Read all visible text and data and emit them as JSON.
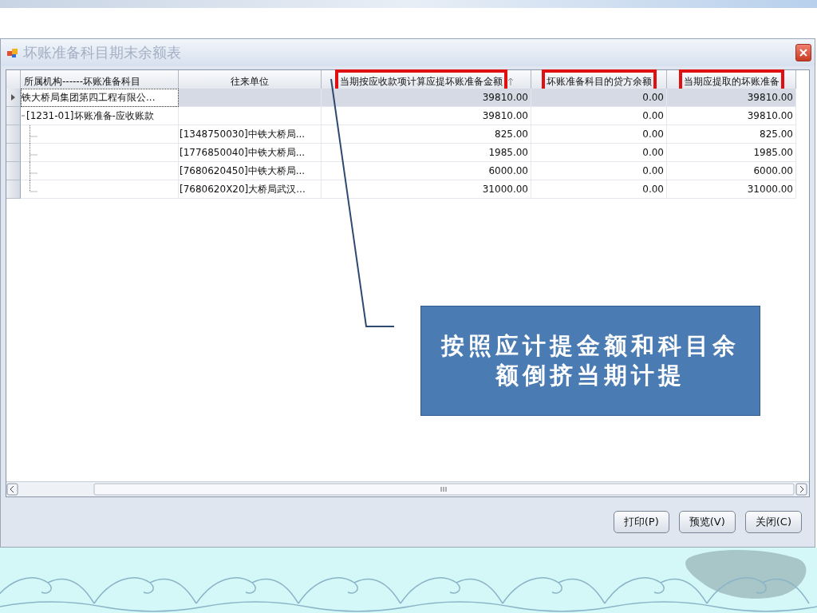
{
  "window": {
    "title": "坏账准备科目期末余额表"
  },
  "table": {
    "columns": [
      {
        "label": "所属机构------坏账准备科目",
        "highlighted": false,
        "sorted": false
      },
      {
        "label": "往来单位",
        "highlighted": false,
        "sorted": false
      },
      {
        "label": "当期按应收款项计算应提坏账准备金额",
        "highlighted": true,
        "sorted": true
      },
      {
        "label": "坏账准备科目的贷方余额",
        "highlighted": true,
        "sorted": false
      },
      {
        "label": "当期应提取的坏账准备",
        "highlighted": true,
        "sorted": false
      }
    ],
    "rows": [
      {
        "kind": "group",
        "selected": true,
        "cells": [
          "铁大桥局集团第四工程有限公...",
          "",
          "39810.00",
          "0.00",
          "39810.00"
        ]
      },
      {
        "kind": "account",
        "selected": false,
        "cells": [
          "[1231-01]坏账准备-应收账款",
          "",
          "39810.00",
          "0.00",
          "39810.00"
        ]
      },
      {
        "kind": "detail",
        "selected": false,
        "cells": [
          "",
          "[1348750030]中铁大桥局...",
          "825.00",
          "0.00",
          "825.00"
        ]
      },
      {
        "kind": "detail",
        "selected": false,
        "cells": [
          "",
          "[1776850040]中铁大桥局...",
          "1985.00",
          "0.00",
          "1985.00"
        ]
      },
      {
        "kind": "detail",
        "selected": false,
        "cells": [
          "",
          "[7680620450]中铁大桥局...",
          "6000.00",
          "0.00",
          "6000.00"
        ]
      },
      {
        "kind": "detail",
        "selected": false,
        "cells": [
          "",
          "[7680620X20]大桥局武汉...",
          "31000.00",
          "0.00",
          "31000.00"
        ]
      }
    ]
  },
  "buttons": [
    "打印(P)",
    "预览(V)",
    "关闭(C)"
  ],
  "callout": {
    "text": "按照应计提金额和科目余额倒挤当期计提"
  }
}
